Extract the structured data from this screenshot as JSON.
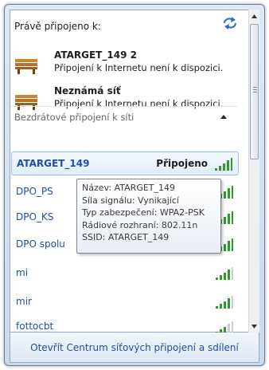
{
  "current": {
    "header": "Právě připojeno k:",
    "connections": [
      {
        "name": "ATARGET_149  2",
        "status": "Připojení k Internetu není k dispozici.",
        "icon": "bench-network-icon"
      },
      {
        "name": "Neznámá síť",
        "status": "Připojení k Internetu není k dispozici.",
        "icon": "bench-network-icon"
      }
    ]
  },
  "wireless": {
    "header": "Bezdrátové připojení k síti",
    "networks": [
      {
        "ssid": "ATARGET_149",
        "state": "Připojeno",
        "signal": 5
      },
      {
        "ssid": "DPO_PS",
        "state": "",
        "signal": 5
      },
      {
        "ssid": "DPO_KS",
        "state": "",
        "signal": 5
      },
      {
        "ssid": "DPO spolu",
        "state": "",
        "signal": 5
      },
      {
        "ssid": "mi",
        "state": "",
        "signal": 4
      },
      {
        "ssid": "mir",
        "state": "",
        "signal": 4
      },
      {
        "ssid": "fottocbt",
        "state": "",
        "signal": 3
      }
    ]
  },
  "tooltip": {
    "lines": [
      "Název: ATARGET_149",
      "Síla signálu: Vynikající",
      "Typ zabezpečení: WPA2-PSK",
      "Rádiové rozhraní: 802.11n",
      "SSID: ATARGET_149"
    ]
  },
  "footer": {
    "link": "Otevřít Centrum síťových připojení a sdílení"
  },
  "colors": {
    "link": "#1f4fa3",
    "signal": "#2e9a2e",
    "selection": "#e2edfb"
  }
}
